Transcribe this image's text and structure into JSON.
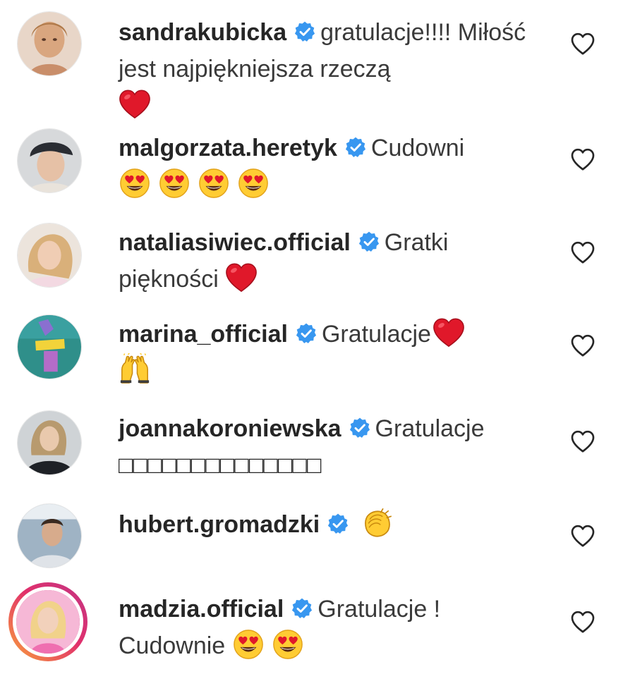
{
  "comments": [
    {
      "username": "sandrakubicka",
      "text": "gratulacje!!!! Miłość jest najpiękniejsza rzeczą",
      "emoji": [
        "red-heart"
      ]
    },
    {
      "username": "malgorzata.heretyk",
      "text": "Cudowni",
      "emoji": [
        "heart-eyes",
        "heart-eyes",
        "heart-eyes",
        "heart-eyes"
      ]
    },
    {
      "username": "nataliasiwiec.official",
      "text": "Gratki piękności",
      "emoji": [
        "red-heart"
      ]
    },
    {
      "username": "marina_official",
      "text": "Gratulacje",
      "emoji": [
        "red-heart",
        "raising-hands"
      ]
    },
    {
      "username": "joannakoroniewska",
      "text": "Gratulacje",
      "tofu": "□□□□□□□□□□□□□□",
      "emoji": []
    },
    {
      "username": "hubert.gromadzki",
      "text": "",
      "emoji": [
        "clapping-hands"
      ]
    },
    {
      "username": "madzia.official",
      "text": "Gratulacje ! Cudownie",
      "emoji": [
        "heart-eyes",
        "heart-eyes"
      ]
    }
  ],
  "icons": {
    "verified": "verified-badge-icon",
    "like": "heart-outline-icon"
  },
  "colors": {
    "verified_badge": "#3897f0",
    "story_ring_start": "#f9a23a",
    "story_ring_end": "#c13584",
    "username": "#262626",
    "heart_emoji": "#e0182a"
  }
}
